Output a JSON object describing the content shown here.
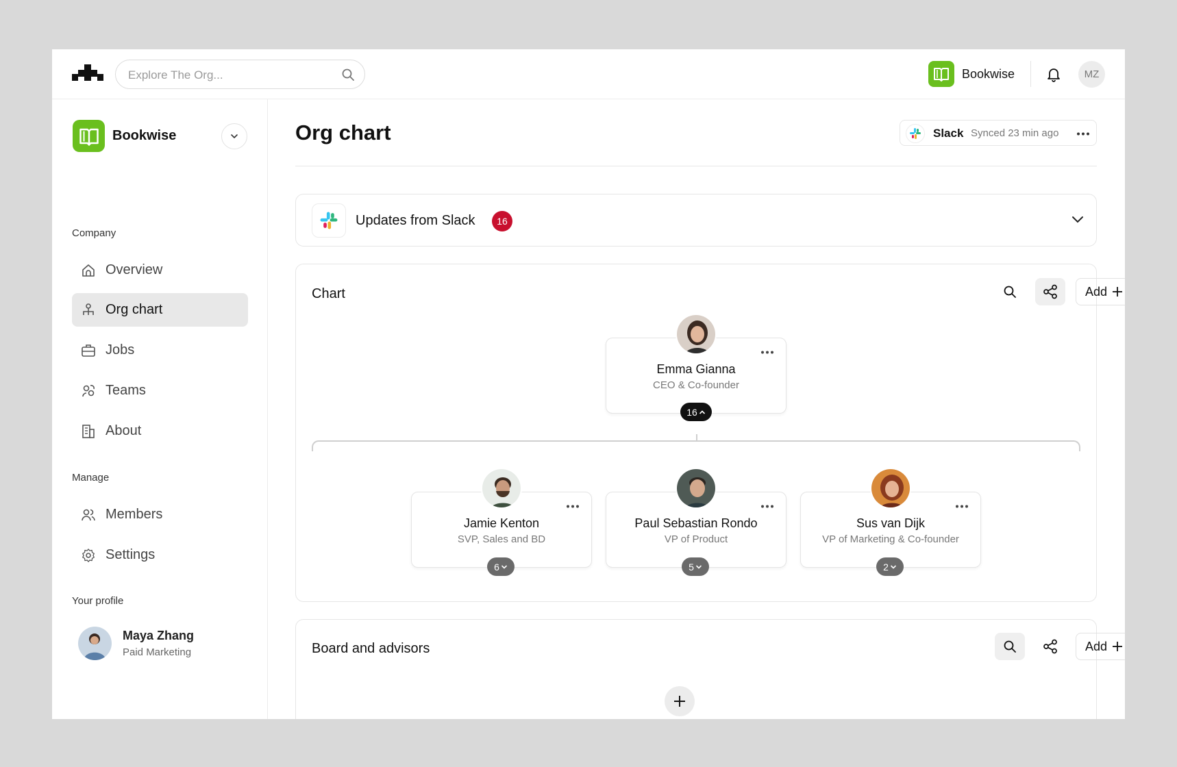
{
  "topbar": {
    "search_placeholder": "Explore The Org...",
    "brand_name": "Bookwise",
    "user_initials": "MZ"
  },
  "sidebar": {
    "workspace_name": "Bookwise",
    "company_label": "Company",
    "company_items": [
      {
        "label": "Overview",
        "icon": "home-icon"
      },
      {
        "label": "Org chart",
        "icon": "org-chart-icon",
        "active": true
      },
      {
        "label": "Jobs",
        "icon": "briefcase-icon"
      },
      {
        "label": "Teams",
        "icon": "teams-icon"
      },
      {
        "label": "About",
        "icon": "building-icon"
      }
    ],
    "manage_label": "Manage",
    "manage_items": [
      {
        "label": "Members",
        "icon": "members-icon"
      },
      {
        "label": "Settings",
        "icon": "gear-icon"
      }
    ],
    "profile_label": "Your profile",
    "profile": {
      "name": "Maya Zhang",
      "role": "Paid Marketing"
    }
  },
  "main": {
    "title": "Org chart",
    "sync": {
      "app": "Slack",
      "status": "Synced 23 min ago"
    },
    "updates": {
      "label": "Updates from Slack",
      "count": "16"
    },
    "chart": {
      "title": "Chart",
      "add_label": "Add",
      "root": {
        "name": "Emma Gianna",
        "title": "CEO & Co-founder",
        "reports": "16"
      },
      "children": [
        {
          "name": "Jamie Kenton",
          "title": "SVP, Sales and BD",
          "reports": "6"
        },
        {
          "name": "Paul Sebastian Rondo",
          "title": "VP of Product",
          "reports": "5"
        },
        {
          "name": "Sus van Dijk",
          "title": "VP of Marketing & Co-founder",
          "reports": "2"
        }
      ]
    },
    "board": {
      "title": "Board and advisors",
      "add_label": "Add"
    }
  },
  "colors": {
    "brand_green": "#6abf1e",
    "badge_red": "#c8102e",
    "active_nav_bg": "#e8e8e8",
    "page_bg": "#d9d9d9"
  }
}
